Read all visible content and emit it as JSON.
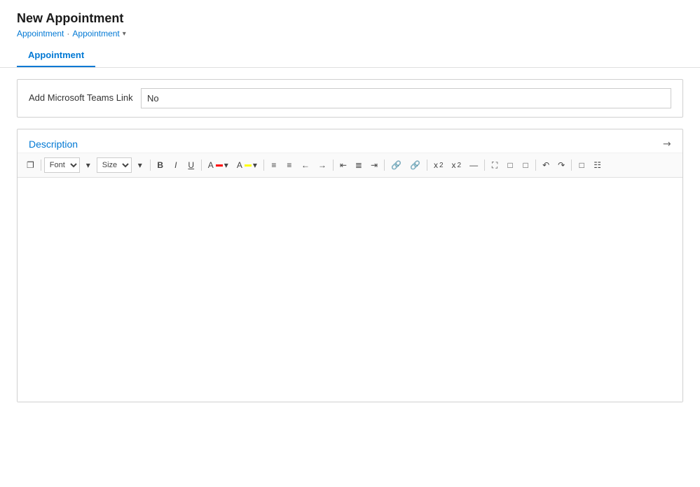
{
  "header": {
    "title": "New Appointment",
    "breadcrumb": {
      "items": [
        "Appointment",
        "Appointment"
      ],
      "separator": "·",
      "dropdown_label": "▾"
    }
  },
  "tabs": [
    {
      "label": "Appointment",
      "active": true
    }
  ],
  "teams_field": {
    "label": "Add Microsoft Teams Link",
    "value": "No",
    "placeholder": "No"
  },
  "description": {
    "heading": "Description",
    "expand_icon": "↗"
  },
  "toolbar": {
    "font_label": "Font",
    "size_label": "Size",
    "bold": "B",
    "italic": "I",
    "underline": "U",
    "buttons": [
      "▾",
      "▾",
      "≡",
      "≡",
      "◂",
      "▸",
      "≡",
      "≡",
      "≡",
      "🔗",
      "🔗",
      "x²",
      "x₂",
      "—",
      "🖼",
      "⊞",
      "⊟",
      "↺",
      "↻",
      "☰",
      "☰"
    ]
  }
}
